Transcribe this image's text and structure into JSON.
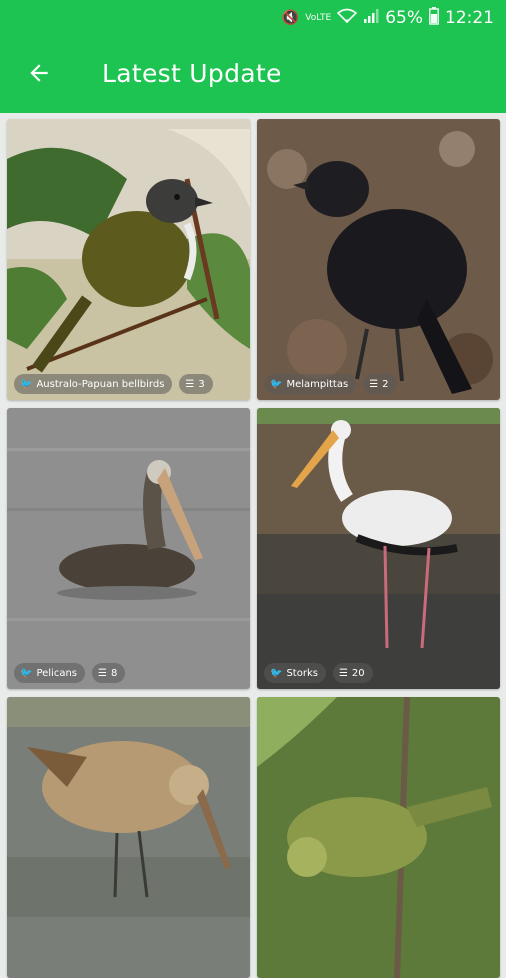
{
  "status_bar": {
    "battery": "65%",
    "time": "12:21",
    "icons": [
      "mute-icon",
      "volte-icon",
      "wifi-icon",
      "signal-icon",
      "battery-icon"
    ]
  },
  "header": {
    "title": "Latest Update",
    "back_icon": "arrow-back-icon",
    "background": "#1ec451"
  },
  "cards": [
    {
      "family": "Australo-Papuan bellbirds",
      "count": "3"
    },
    {
      "family": "Melampittas",
      "count": "2"
    },
    {
      "family": "Pelicans",
      "count": "8"
    },
    {
      "family": "Storks",
      "count": "20"
    },
    {
      "family": "",
      "count": ""
    },
    {
      "family": "",
      "count": ""
    }
  ]
}
